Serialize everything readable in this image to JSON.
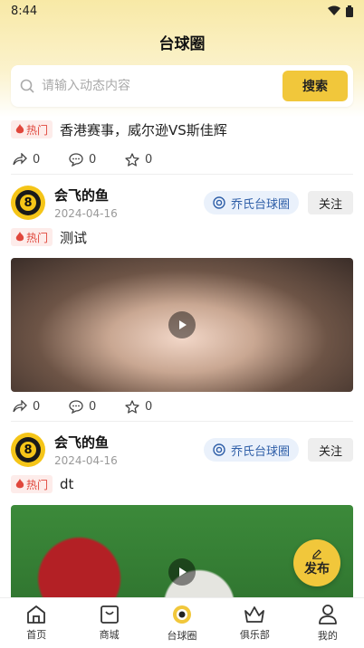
{
  "status_bar": {
    "time": "8:44"
  },
  "header": {
    "title": "台球圈"
  },
  "search": {
    "placeholder": "请输入动态内容",
    "button_label": "搜索"
  },
  "first_post": {
    "hot_label": "热门",
    "title": "香港赛事，威尔逊VS斯佳辉",
    "shares": "0",
    "comments": "0",
    "likes": "0"
  },
  "posts": [
    {
      "author": "会飞的鱼",
      "avatar_number": "8",
      "date": "2024-04-16",
      "circle": "乔氏台球圈",
      "follow_label": "关注",
      "hot_label": "热门",
      "title": "测试",
      "shares": "0",
      "comments": "0",
      "likes": "0"
    },
    {
      "author": "会飞的鱼",
      "avatar_number": "8",
      "date": "2024-04-16",
      "circle": "乔氏台球圈",
      "follow_label": "关注",
      "hot_label": "热门",
      "title": "dt"
    }
  ],
  "fab": {
    "label": "发布"
  },
  "nav": [
    {
      "label": "首页",
      "icon": "home-icon"
    },
    {
      "label": "商城",
      "icon": "shop-icon"
    },
    {
      "label": "台球圈",
      "icon": "billiards-circle-icon"
    },
    {
      "label": "俱乐部",
      "icon": "crown-icon"
    },
    {
      "label": "我的",
      "icon": "user-icon"
    }
  ],
  "colors": {
    "accent": "#f1c73b",
    "hot": "#e0473c",
    "circle": "#2f5fa8"
  }
}
